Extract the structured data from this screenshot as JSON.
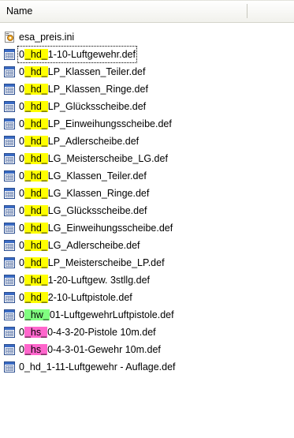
{
  "header": {
    "name_column": "Name"
  },
  "colors": {
    "yellow": "#ffff00",
    "green": "#80ff80",
    "pink": "#ff66cc"
  },
  "files": [
    {
      "icon": "ini-gear-icon",
      "pre": "esa_preis.ini",
      "hl": "",
      "hl_color": "",
      "post": ""
    },
    {
      "icon": "def-file-icon",
      "pre": "0",
      "hl": "_hd_",
      "hl_color": "yellow",
      "post": "1-10-Luftgewehr.def",
      "selected": true
    },
    {
      "icon": "def-file-icon",
      "pre": "0",
      "hl": "_hd_",
      "hl_color": "yellow",
      "post": "LP_Klassen_Teiler.def"
    },
    {
      "icon": "def-file-icon",
      "pre": "0",
      "hl": "_hd_",
      "hl_color": "yellow",
      "post": "LP_Klassen_Ringe.def"
    },
    {
      "icon": "def-file-icon",
      "pre": "0",
      "hl": "_hd_",
      "hl_color": "yellow",
      "post": "LP_Glücksscheibe.def"
    },
    {
      "icon": "def-file-icon",
      "pre": "0",
      "hl": "_hd_",
      "hl_color": "yellow",
      "post": "LP_Einweihungsscheibe.def"
    },
    {
      "icon": "def-file-icon",
      "pre": "0",
      "hl": "_hd_",
      "hl_color": "yellow",
      "post": "LP_Adlerscheibe.def"
    },
    {
      "icon": "def-file-icon",
      "pre": "0",
      "hl": "_hd_",
      "hl_color": "yellow",
      "post": "LG_Meisterscheibe_LG.def"
    },
    {
      "icon": "def-file-icon",
      "pre": "0",
      "hl": "_hd_",
      "hl_color": "yellow",
      "post": "LG_Klassen_Teiler.def"
    },
    {
      "icon": "def-file-icon",
      "pre": "0",
      "hl": "_hd_",
      "hl_color": "yellow",
      "post": "LG_Klassen_Ringe.def"
    },
    {
      "icon": "def-file-icon",
      "pre": "0",
      "hl": "_hd_",
      "hl_color": "yellow",
      "post": "LG_Glücksscheibe.def"
    },
    {
      "icon": "def-file-icon",
      "pre": "0",
      "hl": "_hd_",
      "hl_color": "yellow",
      "post": "LG_Einweihungsscheibe.def"
    },
    {
      "icon": "def-file-icon",
      "pre": "0",
      "hl": "_hd_",
      "hl_color": "yellow",
      "post": "LG_Adlerscheibe.def"
    },
    {
      "icon": "def-file-icon",
      "pre": "0",
      "hl": "_hd_",
      "hl_color": "yellow",
      "post": "LP_Meisterscheibe_LP.def"
    },
    {
      "icon": "def-file-icon",
      "pre": "0",
      "hl": "_hd_",
      "hl_color": "yellow",
      "post": "1-20-Luftgew. 3stllg.def"
    },
    {
      "icon": "def-file-icon",
      "pre": "0",
      "hl": "_hd_",
      "hl_color": "yellow",
      "post": "2-10-Luftpistole.def"
    },
    {
      "icon": "def-file-icon",
      "pre": "0",
      "hl": "_hw_",
      "hl_color": "green",
      "post": "01-LuftgewehrLuftpistole.def"
    },
    {
      "icon": "def-file-icon",
      "pre": "0",
      "hl": "_hs_",
      "hl_color": "pink",
      "post": "0-4-3-20-Pistole 10m.def"
    },
    {
      "icon": "def-file-icon",
      "pre": "0",
      "hl": "_hs_",
      "hl_color": "pink",
      "post": "0-4-3-01-Gewehr 10m.def"
    },
    {
      "icon": "def-file-icon",
      "pre": "0_hd_1-11-Luftgewehr - Auflage.def",
      "hl": "",
      "hl_color": "",
      "post": ""
    }
  ]
}
